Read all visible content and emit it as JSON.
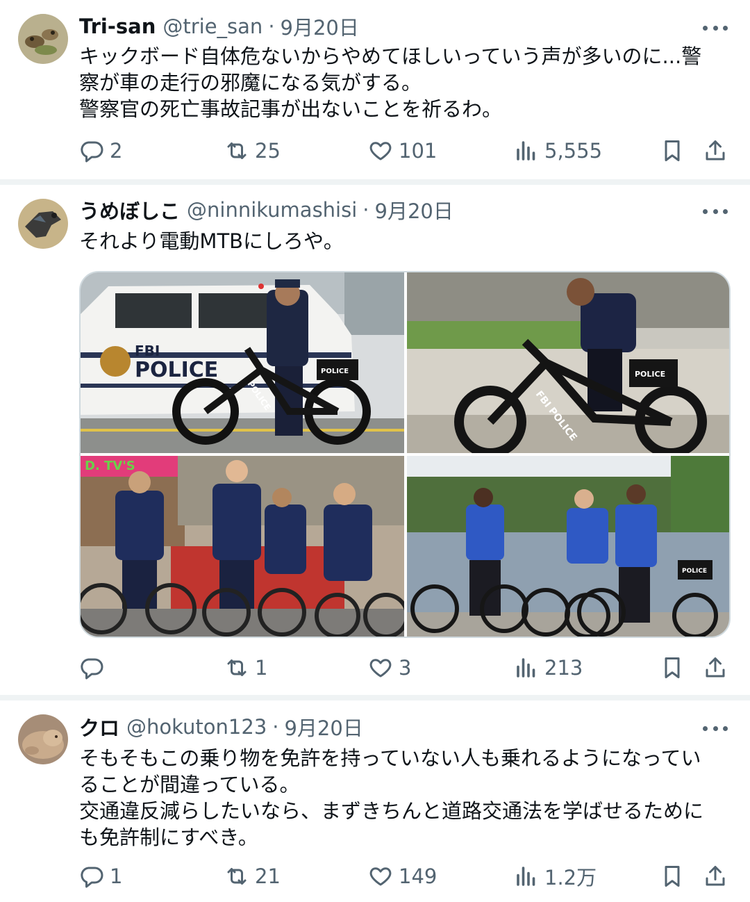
{
  "tweets": [
    {
      "name": "Tri-san",
      "handle": "@trie_san",
      "separator": "·",
      "date": "9月20日",
      "text": "キックボード自体危ないからやめてほしいっていう声が多いのに...警\n察が車の走行の邪魔になる気がする。\n警察官の死亡事故記事が出ないことを祈るわ。",
      "replies": "2",
      "reposts": "25",
      "likes": "101",
      "views": "5,555"
    },
    {
      "name": "うめぼしこ",
      "handle": "@ninnikumashisi",
      "separator": "·",
      "date": "9月20日",
      "text": "それより電動MTBにしろや。",
      "replies": "",
      "reposts": "1",
      "likes": "3",
      "views": "213",
      "media": {
        "photo1_text": [
          "FBI",
          "POLICE",
          "POLICE",
          "POLICE"
        ],
        "photo2_text": [
          "FBI POLICE",
          "POLICE"
        ],
        "photo3_text": [
          "D. TV'S"
        ],
        "photo4_text": [
          "POLICE"
        ]
      }
    },
    {
      "name": "クロ",
      "handle": "@hokuton123",
      "separator": "·",
      "date": "9月20日",
      "text": "そもそもこの乗り物を免許を持っていない人も乗れるようになってい\nることが間違っている。\n交通違反減らしたいなら、まずきちんと道路交通法を学ばせるために\nも免許制にすべき。",
      "replies": "1",
      "reposts": "21",
      "likes": "149",
      "views": "1.2万"
    }
  ],
  "icons": {
    "more": "more-icon",
    "reply": "reply-icon",
    "repost": "repost-icon",
    "like": "like-icon",
    "views": "views-icon",
    "bookmark": "bookmark-icon",
    "share": "share-icon"
  },
  "colors": {
    "text": "#0f1419",
    "secondary": "#536471",
    "divider": "#eff3f4",
    "media_border": "#cfd9de"
  }
}
